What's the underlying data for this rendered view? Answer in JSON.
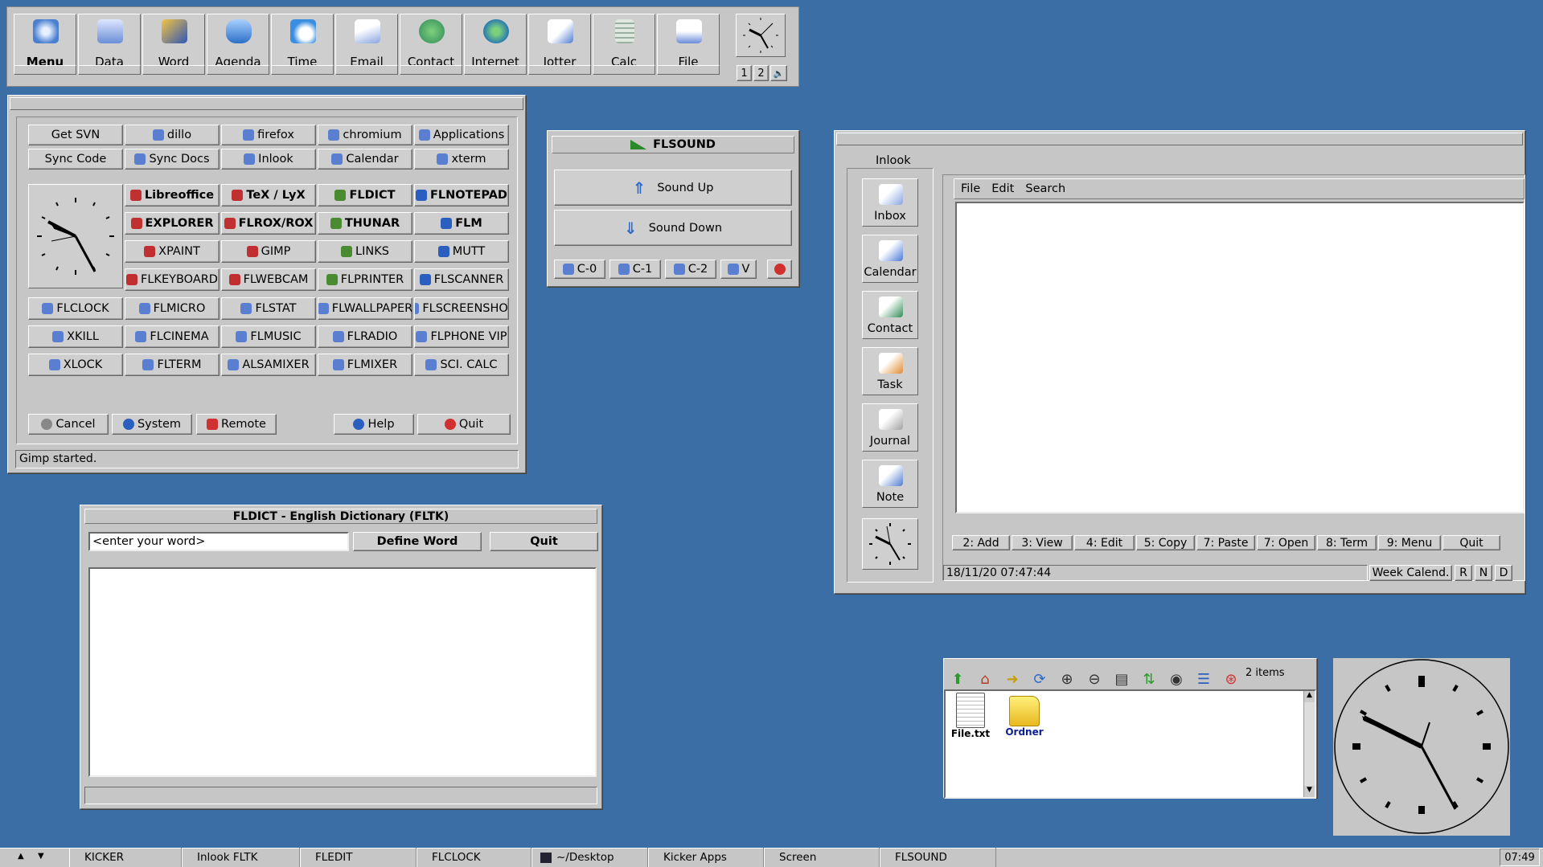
{
  "kicker": {
    "buttons": [
      {
        "label": "Menu",
        "icon": "kde-menu-icon",
        "color": "#5a8fd0"
      },
      {
        "label": "Data",
        "icon": "data-icon",
        "color": "#6b8ed6"
      },
      {
        "label": "Word",
        "icon": "word-icon",
        "color": "#2f56b8"
      },
      {
        "label": "Agenda",
        "icon": "agenda-icon",
        "color": "#4a90e2"
      },
      {
        "label": "Time",
        "icon": "time-icon",
        "color": "#3a8ee0"
      },
      {
        "label": "Email",
        "icon": "email-icon",
        "color": "#8aa4e0"
      },
      {
        "label": "Contact",
        "icon": "contact-icon",
        "color": "#2e8b57"
      },
      {
        "label": "Internet",
        "icon": "internet-icon",
        "color": "#2a7ab0"
      },
      {
        "label": "Jotter",
        "icon": "jotter-icon",
        "color": "#4f7bd0"
      },
      {
        "label": "Calc",
        "icon": "calc-icon",
        "color": "#9ab0a0"
      },
      {
        "label": "File",
        "icon": "file-icon",
        "color": "#6a8cd8"
      }
    ],
    "desk1": "1",
    "desk2": "2"
  },
  "launcher": {
    "rows1": [
      [
        "Get SVN",
        "dillo",
        "firefox",
        "chromium",
        "Applications"
      ],
      [
        "Sync Code",
        "Sync Docs",
        "Inlook",
        "Calendar",
        "xterm"
      ]
    ],
    "apps": [
      [
        "Libreoffice",
        "TeX / LyX",
        "FLDICT",
        "FLNOTEPAD"
      ],
      [
        "EXPLORER",
        "FLROX/ROX",
        "THUNAR",
        "FLM"
      ],
      [
        "XPAINT",
        "GIMP",
        "LINKS",
        "MUTT"
      ],
      [
        "FLKEYBOARD",
        "FLWEBCAM",
        "FLPRINTER",
        "FLSCANNER"
      ]
    ],
    "rows2": [
      [
        "FLCLOCK",
        "FLMICRO",
        "FLSTAT",
        "FLWALLPAPER",
        "FLSCREENSHOT"
      ],
      [
        "XKILL",
        "FLCINEMA",
        "FLMUSIC",
        "FLRADIO",
        "FLPHONE VIP"
      ],
      [
        "XLOCK",
        "FLTERM",
        "ALSAMIXER",
        "FLMIXER",
        "SCI. CALC"
      ]
    ],
    "cancel": "Cancel",
    "system": "System",
    "remote": "Remote",
    "help": "Help",
    "quit": "Quit",
    "status": "Gimp started."
  },
  "flsound": {
    "title": "FLSOUND",
    "up": "Sound Up",
    "down": "Sound Down",
    "channels": [
      "C-0",
      "C-1",
      "C-2",
      "V"
    ]
  },
  "inlook": {
    "label": "Inlook",
    "side": [
      "Inbox",
      "Calendar",
      "Contact",
      "Task",
      "Journal",
      "Note"
    ],
    "menu": [
      "File",
      "Edit",
      "Search"
    ],
    "bottom": [
      "2: Add",
      "3: View",
      "4: Edit",
      "5: Copy",
      "7: Paste",
      "7: Open",
      "8: Term",
      "9: Menu",
      "Quit"
    ],
    "datetime": "18/11/20 07:47:44",
    "week": "Week Calend.",
    "r": "R",
    "n": "N",
    "d": "D"
  },
  "fldict": {
    "title": "FLDICT - English Dictionary (FLTK)",
    "input": "<enter your word>",
    "define": "Define Word",
    "quit": "Quit"
  },
  "filemgr": {
    "count": "2 items",
    "files": [
      {
        "name": "File.txt"
      },
      {
        "name": "Ordner"
      }
    ]
  },
  "taskbar": {
    "items": [
      "KICKER",
      "Inlook FLTK",
      "FLEDIT",
      "FLCLOCK",
      "~/Desktop",
      "Kicker Apps",
      "Screen",
      "FLSOUND"
    ],
    "clock": "07:49"
  }
}
